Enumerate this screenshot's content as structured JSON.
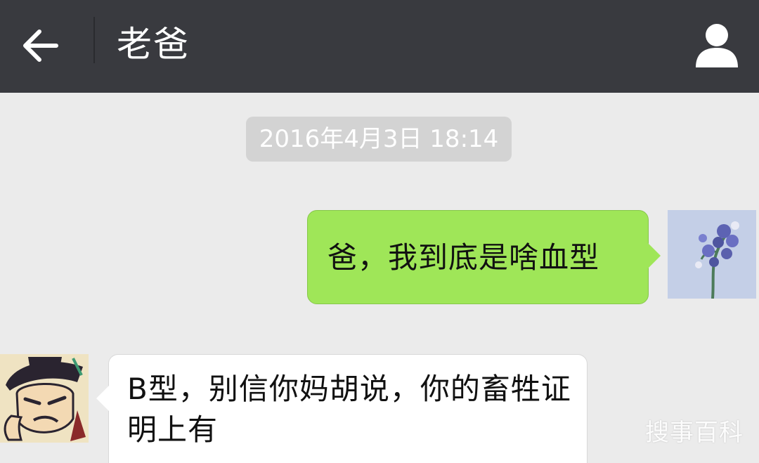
{
  "header": {
    "title": "老爸",
    "back_icon": "back-arrow-icon",
    "profile_icon": "person-icon"
  },
  "chat": {
    "timestamp": "2016年4月3日 18:14",
    "messages": [
      {
        "side": "right",
        "text": "爸，我到底是啥血型",
        "avatar_icon": "flower-avatar"
      },
      {
        "side": "left",
        "text": "B型，别信你妈胡说，你的畜牲证明上有",
        "avatar_icon": "cartoon-avatar"
      }
    ]
  },
  "watermark": "搜事百科",
  "colors": {
    "header_bg": "#393a3f",
    "chat_bg": "#ebebeb",
    "sent_bubble": "#9fe658",
    "received_bubble": "#ffffff",
    "timestamp_bg": "#d3d3d3"
  }
}
